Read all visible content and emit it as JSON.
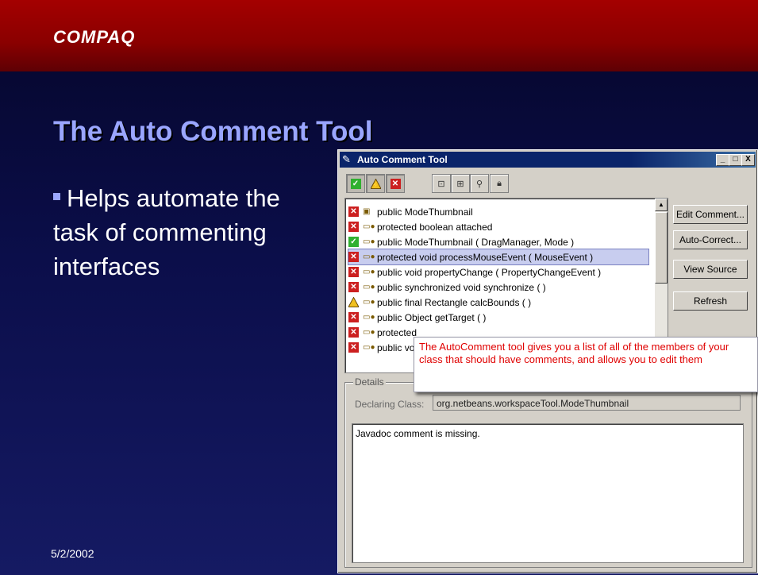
{
  "slide": {
    "logo": "COMPAQ",
    "title": "The Auto Comment Tool",
    "bullet": "Helps automate the task of commenting interfaces",
    "date": "5/2/2002"
  },
  "window": {
    "title": "Auto Comment Tool",
    "controls": {
      "minimize": "_",
      "maximize": "□",
      "close": "X"
    },
    "toolbar": [
      {
        "name": "filter-ok-button",
        "icon": "check-icon"
      },
      {
        "name": "filter-warning-button",
        "icon": "warning-icon"
      },
      {
        "name": "filter-error-button",
        "icon": "error-icon"
      },
      {
        "name": "filter-public-button",
        "icon": "public-icon"
      },
      {
        "name": "filter-protected-button",
        "icon": "protected-icon"
      },
      {
        "name": "filter-package-button",
        "icon": "package-icon"
      },
      {
        "name": "filter-private-button",
        "icon": "private-icon"
      }
    ],
    "members": [
      {
        "status": "error",
        "kind": "class",
        "text": "public ModeThumbnail"
      },
      {
        "status": "error",
        "kind": "field",
        "text": "protected boolean attached"
      },
      {
        "status": "ok",
        "kind": "method",
        "text": "public ModeThumbnail ( DragManager, Mode )"
      },
      {
        "status": "error",
        "kind": "method",
        "text": "protected void processMouseEvent ( MouseEvent )",
        "selected": true
      },
      {
        "status": "error",
        "kind": "method",
        "text": "public void propertyChange ( PropertyChangeEvent )"
      },
      {
        "status": "error",
        "kind": "method",
        "text": "public synchronized void synchronize ( )"
      },
      {
        "status": "warning",
        "kind": "method",
        "text": "public final Rectangle calcBounds ( )"
      },
      {
        "status": "error",
        "kind": "method",
        "text": "public Object getTarget ( )"
      },
      {
        "status": "error",
        "kind": "method",
        "text": "protected"
      },
      {
        "status": "error",
        "kind": "method",
        "text": "public vo"
      }
    ],
    "buttons": {
      "edit_comment": "Edit Comment...",
      "auto_correct": "Auto-Correct...",
      "view_source": "View Source",
      "refresh": "Refresh"
    },
    "details": {
      "legend": "Details",
      "declaring_class_label": "Declaring Class:",
      "declaring_class_value": "org.netbeans.workspaceTool.ModeThumbnail",
      "comment_text": "Javadoc comment is missing."
    }
  },
  "callout": {
    "text": "The AutoComment tool gives you a list of all of the members of your class that should have comments, and allows you to edit them"
  },
  "colors": {
    "header_red": "#9a0000",
    "title_blue": "#9aa6ff",
    "callout_red": "#e00000",
    "selection": "#c8cdef"
  }
}
